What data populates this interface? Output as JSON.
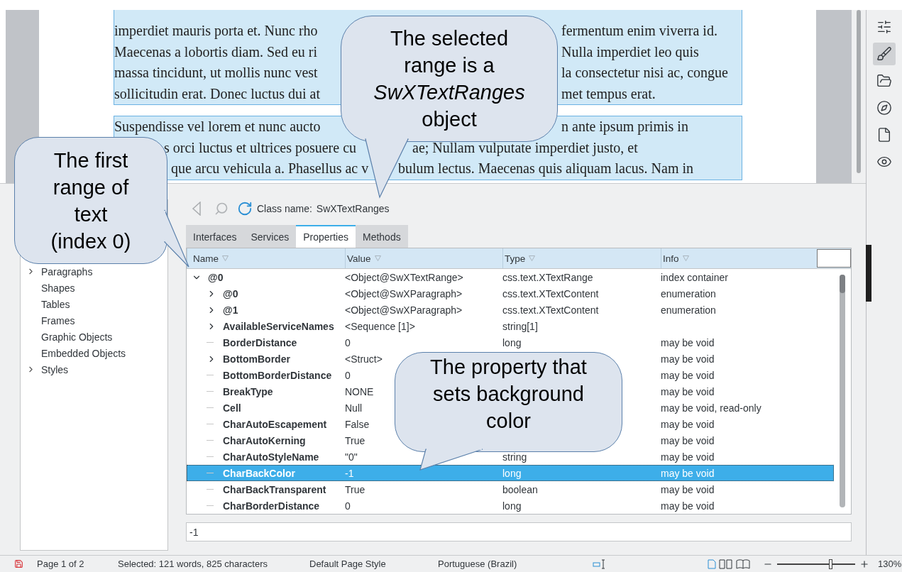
{
  "document": {
    "paragraphs": [
      {
        "lines": [
          {
            "left": "imperdiet mauris porta et. Nunc rho",
            "right": "fermentum enim viverra id."
          },
          {
            "left": "Maecenas a lobortis diam. Sed eu ri",
            "right": "Nulla imperdiet leo quis"
          },
          {
            "left": "massa tincidunt, ut mollis nunc vest",
            "right": "la consectetur nisi ac, congue"
          },
          {
            "left": "sollicitudin erat. Donec luctus dui at",
            "right": "met tempus erat."
          }
        ]
      },
      {
        "lines": [
          {
            "left": "Suspendisse vel lorem et nunc aucto",
            "right": "n ante ipsum primis in"
          },
          {
            "left": "s orci luctus et ultrices posuere cu",
            "right": "ae; Nullam vulputate imperdiet justo, et"
          },
          {
            "left": "que arcu vehicula a. Phasellus ac v",
            "right": "bulum lectus. Maecenas quis aliquam lacus. Nam in"
          }
        ]
      }
    ]
  },
  "callouts": [
    {
      "text": "The first range of text (index 0)"
    },
    {
      "text": "The selected range is a *SwXTextRanges* object"
    },
    {
      "text": "The property that sets background color"
    }
  ],
  "inspector": {
    "tree": {
      "items": [
        {
          "label": "Paragraphs",
          "expanded": false
        },
        {
          "label": "Shapes"
        },
        {
          "label": "Tables"
        },
        {
          "label": "Frames"
        },
        {
          "label": "Graphic Objects"
        },
        {
          "label": "Embedded Objects"
        },
        {
          "label": "Styles",
          "expanded": false
        }
      ]
    },
    "toolbar": {
      "back_disabled": true,
      "class_label": "Class name:",
      "class_value": "SwXTextRanges"
    },
    "tabs": [
      {
        "label": "Interfaces",
        "selected": false
      },
      {
        "label": "Services",
        "selected": false
      },
      {
        "label": "Properties",
        "selected": true
      },
      {
        "label": "Methods",
        "selected": false
      }
    ],
    "columns": [
      "Name",
      "Value",
      "Type",
      "Info"
    ],
    "rows": [
      {
        "name": "@0",
        "value": "<Object@SwXTextRange>",
        "type": "css.text.XTextRange",
        "info": "index container",
        "expanded": true,
        "selected": false,
        "children": [
          {
            "name": "@0",
            "value": "<Object@SwXParagraph>",
            "type": "css.text.XTextContent",
            "info": "enumeration",
            "expanded": false,
            "selected": false
          },
          {
            "name": "@1",
            "value": "<Object@SwXParagraph>",
            "type": "css.text.XTextContent",
            "info": "enumeration",
            "expanded": false,
            "selected": false
          },
          {
            "name": "AvailableServiceNames",
            "value": "<Sequence [1]>",
            "type": "string[1]",
            "expanded": false,
            "selected": false
          },
          {
            "name": "BorderDistance",
            "value": "0",
            "type": "long",
            "info": "may be void",
            "selected": false
          },
          {
            "name": "BottomBorder",
            "value": "<Struct>",
            "info": "may be void",
            "expanded": false,
            "selected": false
          },
          {
            "name": "BottomBorderDistance",
            "value": "0",
            "info": "may be void",
            "selected": false
          },
          {
            "name": "BreakType",
            "value": "NONE",
            "info": "may be void",
            "selected": false
          },
          {
            "name": "Cell",
            "value": "Null",
            "info": "may be void, read-only",
            "selected": false
          },
          {
            "name": "CharAutoEscapement",
            "value": "False",
            "info": "may be void",
            "selected": false
          },
          {
            "name": "CharAutoKerning",
            "value": "True",
            "info": "may be void",
            "selected": false
          },
          {
            "name": "CharAutoStyleName",
            "value": "\"0\"",
            "type": "string",
            "info": "may be void",
            "selected": false
          },
          {
            "name": "CharBackColor",
            "value": "-1",
            "type": "long",
            "info": "may be void",
            "selected": true
          },
          {
            "name": "CharBackTransparent",
            "value": "True",
            "type": "boolean",
            "info": "may be void",
            "selected": false
          },
          {
            "name": "CharBorderDistance",
            "value": "0",
            "type": "long",
            "info": "may be void",
            "selected": false
          }
        ]
      }
    ],
    "value_field": "-1"
  },
  "sidebar": {
    "items": [
      {
        "kind": "properties",
        "selected": false
      },
      {
        "kind": "styles",
        "selected": true
      },
      {
        "kind": "gallery",
        "selected": false
      },
      {
        "kind": "navigator",
        "selected": false
      },
      {
        "kind": "page",
        "selected": false
      },
      {
        "kind": "inspector",
        "selected": false
      }
    ]
  },
  "status_bar": {
    "page": "Page 1 of 2",
    "selection": "Selected: 121 words, 825 characters",
    "page_style": "Default Page Style",
    "language": "Portuguese (Brazil)",
    "zoom": {
      "level": 0.68,
      "reading": "130%"
    }
  }
}
